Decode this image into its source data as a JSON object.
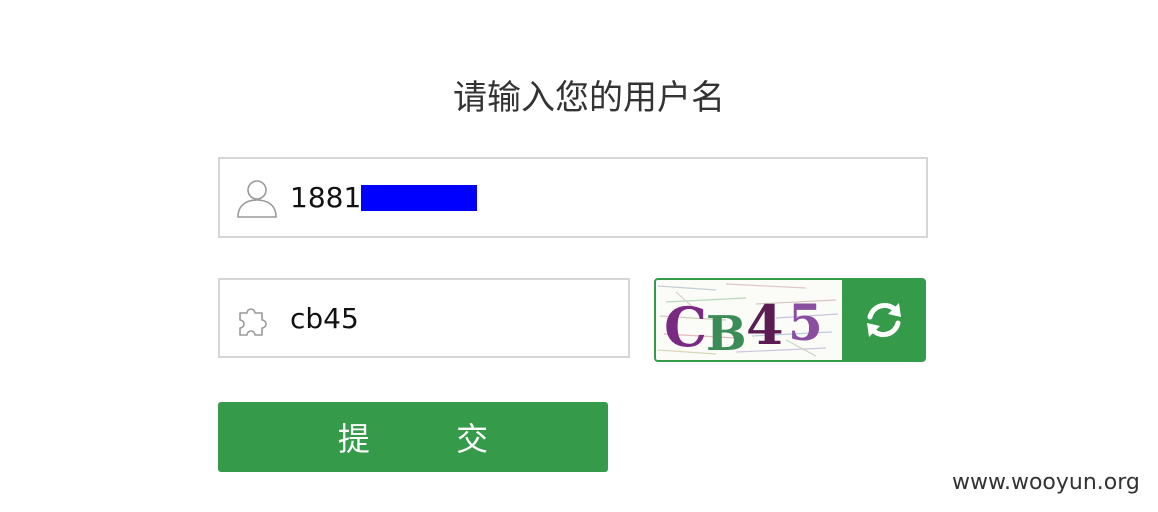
{
  "form": {
    "title": "请输入您的用户名",
    "username": {
      "icon": "user-icon",
      "visible_prefix": "1881",
      "redacted": true,
      "redaction_color": "#0000ff"
    },
    "captcha": {
      "icon": "puzzle-icon",
      "value": "cb45",
      "image_text": "CB45",
      "refresh_icon": "refresh-icon"
    },
    "submit_label": "提 交"
  },
  "colors": {
    "accent": "#359a4a",
    "border": "#d6d6d6",
    "text": "#333333"
  },
  "watermark": "www.wooyun.org"
}
